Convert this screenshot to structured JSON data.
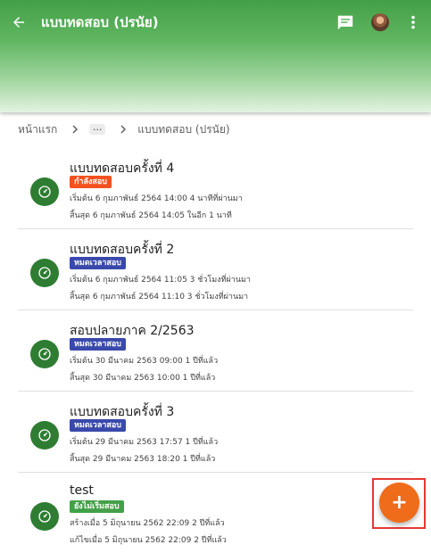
{
  "appbar": {
    "title": "แบบทดสอบ (ปรนัย)",
    "back_icon": "arrow-left-icon",
    "chat_icon": "chat-icon",
    "more_icon": "more-vert-icon"
  },
  "breadcrumb": {
    "home": "หน้าแรก",
    "ellipsis": "...",
    "current": "แบบทดสอบ (ปรนัย)"
  },
  "colors": {
    "appbar": "#43a047",
    "icon_circle": "#2e7d32",
    "status_active": "#f4511e",
    "status_expired": "#3949ab",
    "status_not_started": "#43a047",
    "fab": "#ef6c1a"
  },
  "items": [
    {
      "name": "แบบทดสอบครั้งที่ 4",
      "status": "กำลังสอบ",
      "line1": "เริ่มต้น 6 กุมภาพันธ์ 2564 14:00 4 นาทีที่ผ่านมา",
      "line2": "สิ้นสุด 6 กุมภาพันธ์ 2564 14:05 ในอีก 1 นาที"
    },
    {
      "name": "แบบทดสอบครั้งที่ 2",
      "status": "หมดเวลาสอบ",
      "line1": "เริ่มต้น 6 กุมภาพันธ์ 2564 11:05 3 ชั่วโมงที่ผ่านมา",
      "line2": "สิ้นสุด 6 กุมภาพันธ์ 2564 11:10 3 ชั่วโมงที่ผ่านมา"
    },
    {
      "name": "สอบปลายภาค 2/2563",
      "status": "หมดเวลาสอบ",
      "line1": "เริ่มต้น 30 มีนาคม 2563 09:00 1 ปีที่แล้ว",
      "line2": "สิ้นสุด 30 มีนาคม 2563 10:00 1 ปีที่แล้ว"
    },
    {
      "name": "แบบทดสอบครั้งที่ 3",
      "status": "หมดเวลาสอบ",
      "line1": "เริ่มต้น 29 มีนาคม 2563 17:57 1 ปีที่แล้ว",
      "line2": "สิ้นสุด 29 มีนาคม 2563 18:20 1 ปีที่แล้ว"
    },
    {
      "name": "test",
      "status": "ยังไม่เริ่มสอบ",
      "line1": "สร้างเมื่อ 5 มิถุนายน 2562 22:09 2 ปีที่แล้ว",
      "line2": "แก้ไขเมื่อ 5 มิถุนายน 2562 22:09 2 ปีที่แล้ว"
    }
  ],
  "fab": {
    "label": "+",
    "icon": "plus-icon"
  }
}
